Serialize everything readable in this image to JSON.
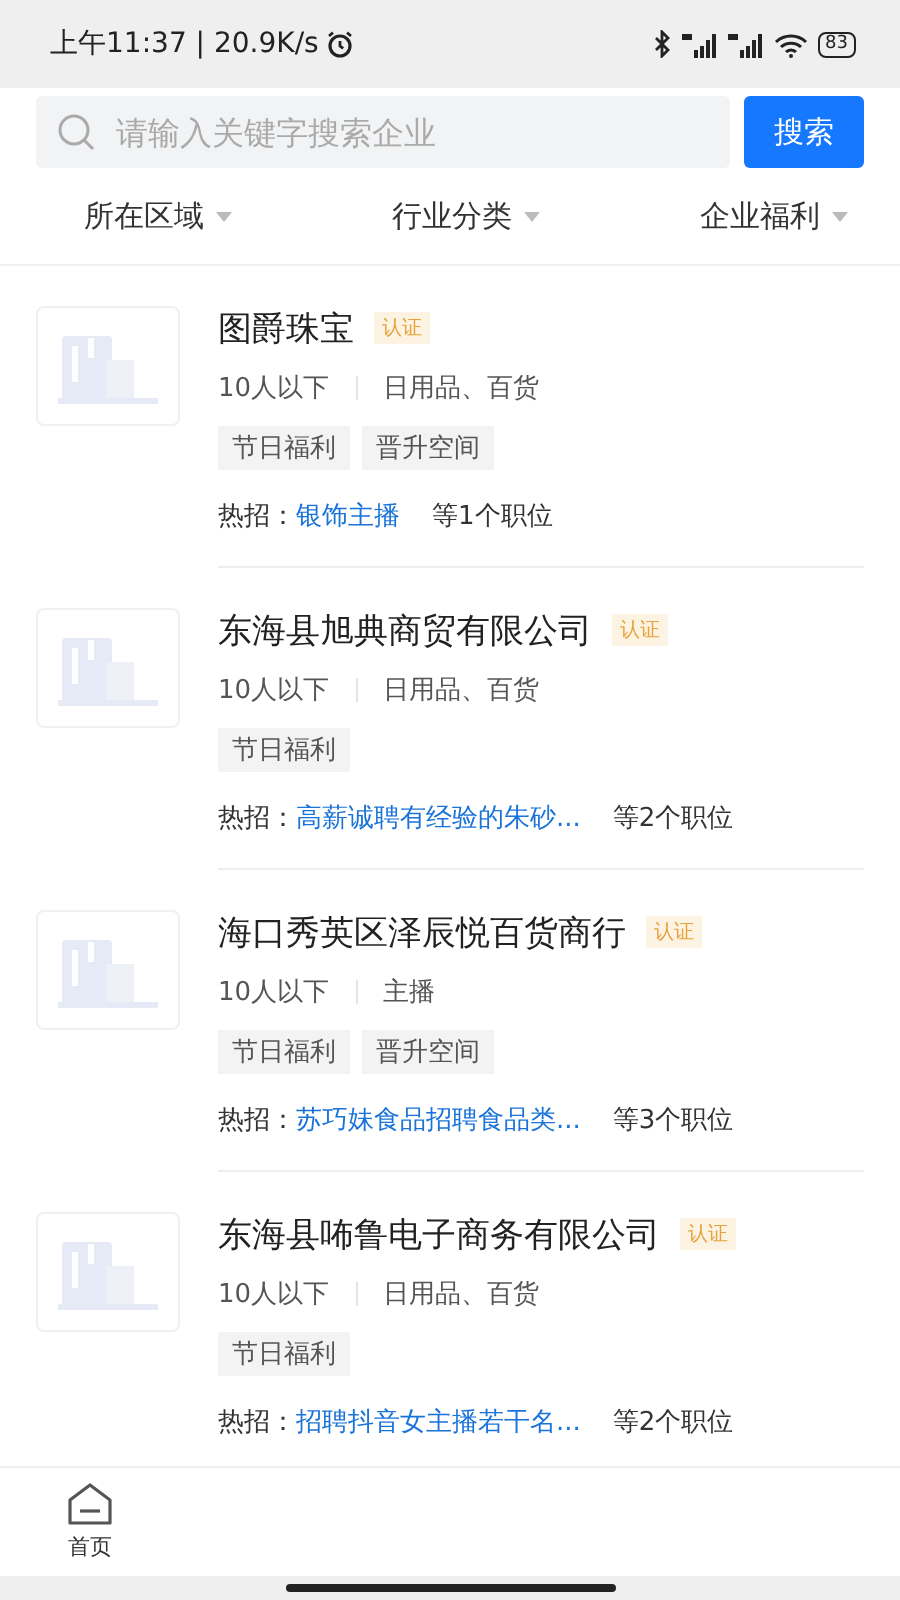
{
  "status_bar": {
    "time": "上午11:37 | 20.9K/s",
    "battery": "83"
  },
  "search": {
    "placeholder": "请输入关键字搜索企业",
    "button": "搜索"
  },
  "filters": [
    {
      "label": "所在区域"
    },
    {
      "label": "行业分类"
    },
    {
      "label": "企业福利"
    }
  ],
  "companies": [
    {
      "name": "图爵珠宝",
      "badge": "认证",
      "size": "10人以下",
      "industry": "日用品、百货",
      "tags": [
        "节日福利",
        "晋升空间"
      ],
      "hot_label": "热招：",
      "hot_job": "银饰主播",
      "count": "等1个职位"
    },
    {
      "name": "东海县旭典商贸有限公司",
      "badge": "认证",
      "size": "10人以下",
      "industry": "日用品、百货",
      "tags": [
        "节日福利"
      ],
      "hot_label": "热招：",
      "hot_job": "高薪诚聘有经验的朱砂...",
      "count": "等2个职位"
    },
    {
      "name": "海口秀英区泽辰悦百货商行",
      "badge": "认证",
      "size": "10人以下",
      "industry": "主播",
      "tags": [
        "节日福利",
        "晋升空间"
      ],
      "hot_label": "热招：",
      "hot_job": "苏巧妹食品招聘食品类...",
      "count": "等3个职位"
    },
    {
      "name": "东海县咘鲁电子商务有限公司",
      "badge": "认证",
      "size": "10人以下",
      "industry": "日用品、百货",
      "tags": [
        "节日福利"
      ],
      "hot_label": "热招：",
      "hot_job": "招聘抖音女主播若干名...",
      "count": "等2个职位"
    }
  ],
  "nav": [
    {
      "label": "首页"
    }
  ]
}
